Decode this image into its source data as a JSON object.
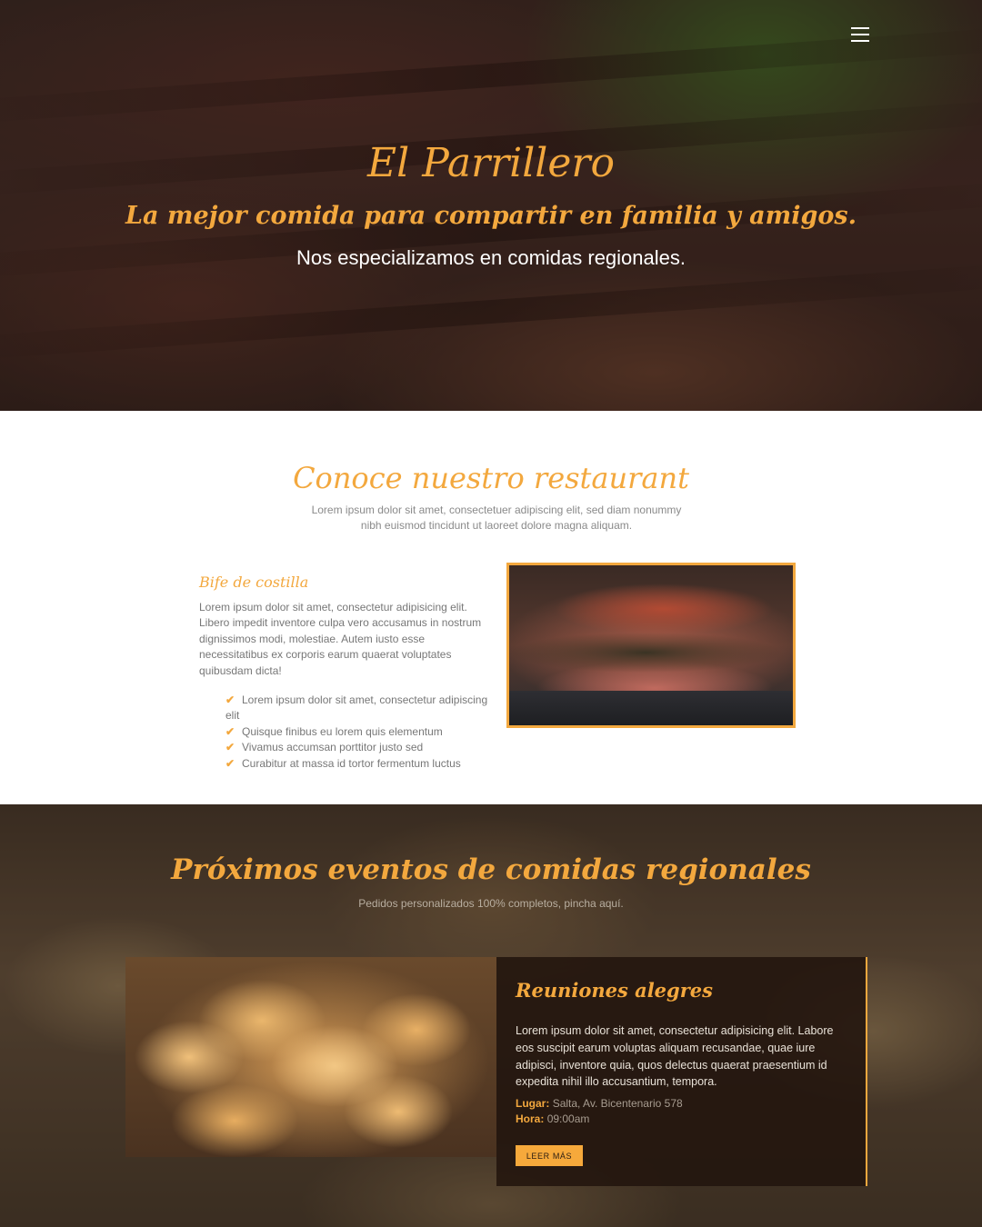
{
  "hero": {
    "title": "El Parrillero",
    "subtitle": "La mejor comida para compartir en familia y amigos.",
    "tagline": "Nos especializamos en comidas regionales.",
    "menu_icon": "hamburger-menu-icon"
  },
  "about": {
    "title": "Conoce nuestro restaurant",
    "intro": "Lorem ipsum dolor sit amet, consectetuer adipiscing elit, sed diam nonummy nibh euismod tincidunt ut laoreet dolore magna aliquam.",
    "dish": {
      "title": "Bife de costilla",
      "description": "Lorem ipsum dolor sit amet, consectetur adipisicing elit. Libero impedit inventore culpa vero accusamus in nostrum dignissimos modi, molestiae. Autem iusto esse necessitatibus ex corporis earum quaerat voluptates quibusdam dicta!",
      "features": [
        "Lorem ipsum dolor sit amet, consectetur adipiscing elit",
        "Quisque finibus eu lorem quis elementum",
        "Vivamus accumsan porttitor justo sed",
        "Curabitur at massa id tortor fermentum luctus"
      ],
      "check_icon": "checkmark-icon"
    }
  },
  "events": {
    "title": "Próximos eventos de comidas regionales",
    "subtitle": "Pedidos personalizados 100% completos, pincha aquí.",
    "card": {
      "title": "Reuniones alegres",
      "description": "Lorem ipsum dolor sit amet, consectetur adipisicing elit. Labore eos suscipit earum voluptas aliquam recusandae, quae iure adipisci, inventore quia, quos delectus quaerat praesentium id expedita nihil illo accusantium, tempora.",
      "place_label": "Lugar:",
      "place_value": "Salta, Av. Bicentenario 578",
      "time_label": "Hora:",
      "time_value": "09:00am",
      "button_label": "LEER MÁS"
    }
  },
  "colors": {
    "accent": "#f3a83e",
    "body_text": "#777777",
    "card_bg": "#22140e"
  }
}
